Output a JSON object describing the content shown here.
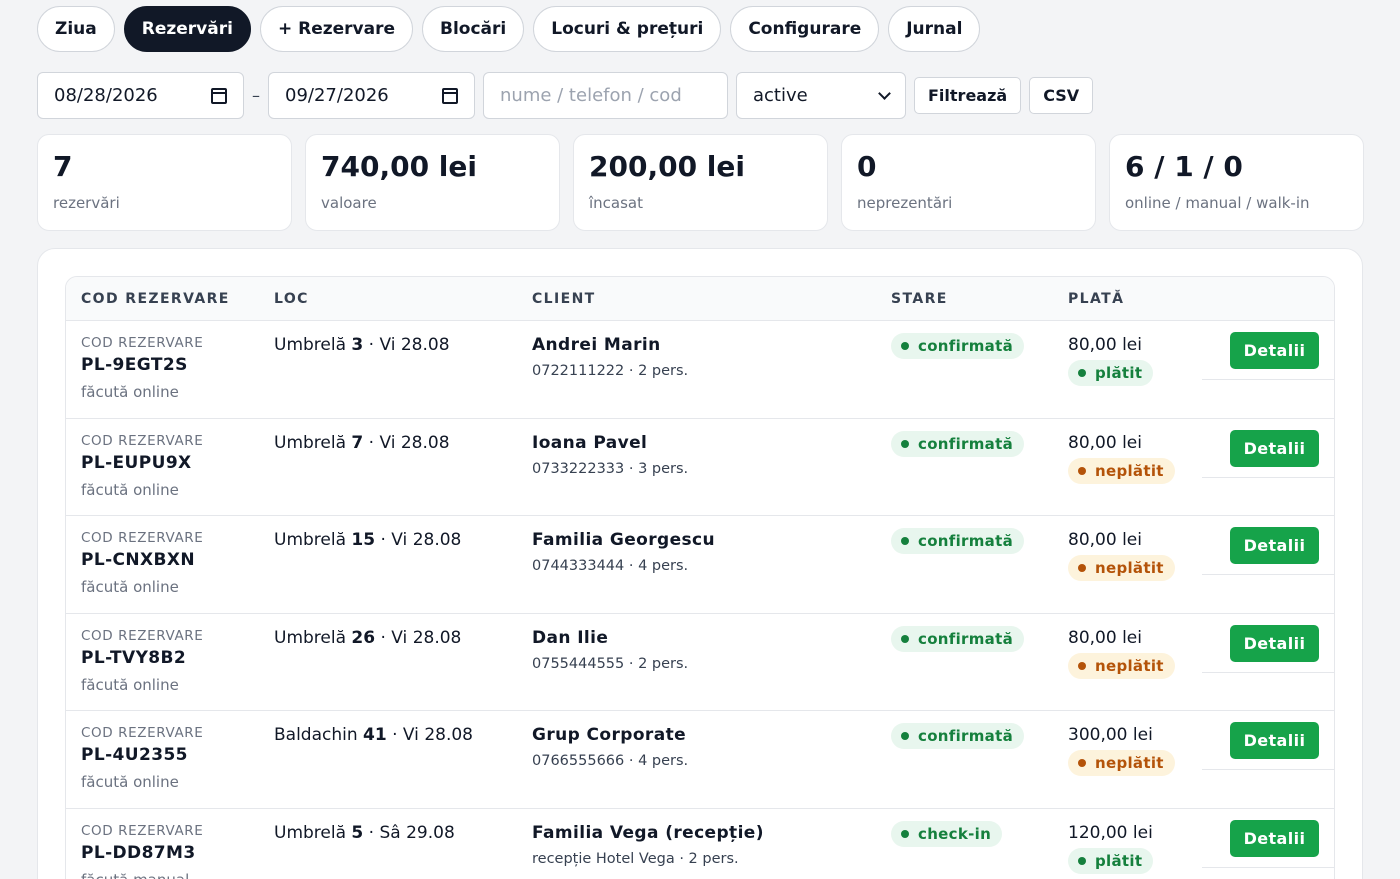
{
  "tabs": [
    {
      "label": "Ziua",
      "active": false
    },
    {
      "label": "Rezervări",
      "active": true
    },
    {
      "label": "+ Rezervare",
      "active": false
    },
    {
      "label": "Blocări",
      "active": false
    },
    {
      "label": "Locuri & prețuri",
      "active": false
    },
    {
      "label": "Configurare",
      "active": false
    },
    {
      "label": "Jurnal",
      "active": false
    }
  ],
  "filters": {
    "date_from": "08/28/2026",
    "date_separator": "–",
    "date_to": "09/27/2026",
    "search_placeholder": "nume / telefon / cod",
    "status_value": "active",
    "filter_button": "Filtrează",
    "csv_button": "CSV"
  },
  "stats": [
    {
      "value": "7",
      "label": "rezervări"
    },
    {
      "value": "740,00 lei",
      "label": "valoare"
    },
    {
      "value": "200,00 lei",
      "label": "încasat"
    },
    {
      "value": "0",
      "label": "neprezentări"
    },
    {
      "value": "6 / 1 / 0",
      "label": "online / manual / walk-in"
    }
  ],
  "table": {
    "headers": {
      "code": "COD REZERVARE",
      "loc": "LOC",
      "client": "CLIENT",
      "state": "STARE",
      "pay": "PLATĂ"
    },
    "rows": [
      {
        "code_caption": "COD REZERVARE",
        "code": "PL-9EGT2S",
        "source": "făcută online",
        "loc_type": "Umbrelă",
        "loc_num": "3",
        "loc_date": " · Vi 28.08",
        "client": "Andrei Marin",
        "client_sub": "0722111222 · 2 pers.",
        "state": "confirmată",
        "amount": "80,00 lei",
        "pay_status": "plătit",
        "pay_color": "green",
        "action": "Detalii"
      },
      {
        "code_caption": "COD REZERVARE",
        "code": "PL-EUPU9X",
        "source": "făcută online",
        "loc_type": "Umbrelă",
        "loc_num": "7",
        "loc_date": " · Vi 28.08",
        "client": "Ioana Pavel",
        "client_sub": "0733222333 · 3 pers.",
        "state": "confirmată",
        "amount": "80,00 lei",
        "pay_status": "neplătit",
        "pay_color": "amber",
        "action": "Detalii"
      },
      {
        "code_caption": "COD REZERVARE",
        "code": "PL-CNXBXN",
        "source": "făcută online",
        "loc_type": "Umbrelă",
        "loc_num": "15",
        "loc_date": " · Vi 28.08",
        "client": "Familia Georgescu",
        "client_sub": "0744333444 · 4 pers.",
        "state": "confirmată",
        "amount": "80,00 lei",
        "pay_status": "neplătit",
        "pay_color": "amber",
        "action": "Detalii"
      },
      {
        "code_caption": "COD REZERVARE",
        "code": "PL-TVY8B2",
        "source": "făcută online",
        "loc_type": "Umbrelă",
        "loc_num": "26",
        "loc_date": " · Vi 28.08",
        "client": "Dan Ilie",
        "client_sub": "0755444555 · 2 pers.",
        "state": "confirmată",
        "amount": "80,00 lei",
        "pay_status": "neplătit",
        "pay_color": "amber",
        "action": "Detalii"
      },
      {
        "code_caption": "COD REZERVARE",
        "code": "PL-4U2355",
        "source": "făcută online",
        "loc_type": "Baldachin",
        "loc_num": "41",
        "loc_date": " · Vi 28.08",
        "client": "Grup Corporate",
        "client_sub": "0766555666 · 4 pers.",
        "state": "confirmată",
        "amount": "300,00 lei",
        "pay_status": "neplătit",
        "pay_color": "amber",
        "action": "Detalii"
      },
      {
        "code_caption": "COD REZERVARE",
        "code": "PL-DD87M3",
        "source": "făcută manual",
        "loc_type": "Umbrelă",
        "loc_num": "5",
        "loc_date": " · Sâ 29.08",
        "client": "Familia Vega (recepție)",
        "client_sub": "recepție Hotel Vega · 2 pers.",
        "state": "check-in",
        "amount": "120,00 lei",
        "pay_status": "plătit",
        "pay_color": "green",
        "action": "Detalii"
      }
    ]
  },
  "colors": {
    "accent_green": "#16a34a",
    "status_green": "#15803d",
    "status_amber": "#b45309",
    "active_tab": "#111827"
  }
}
